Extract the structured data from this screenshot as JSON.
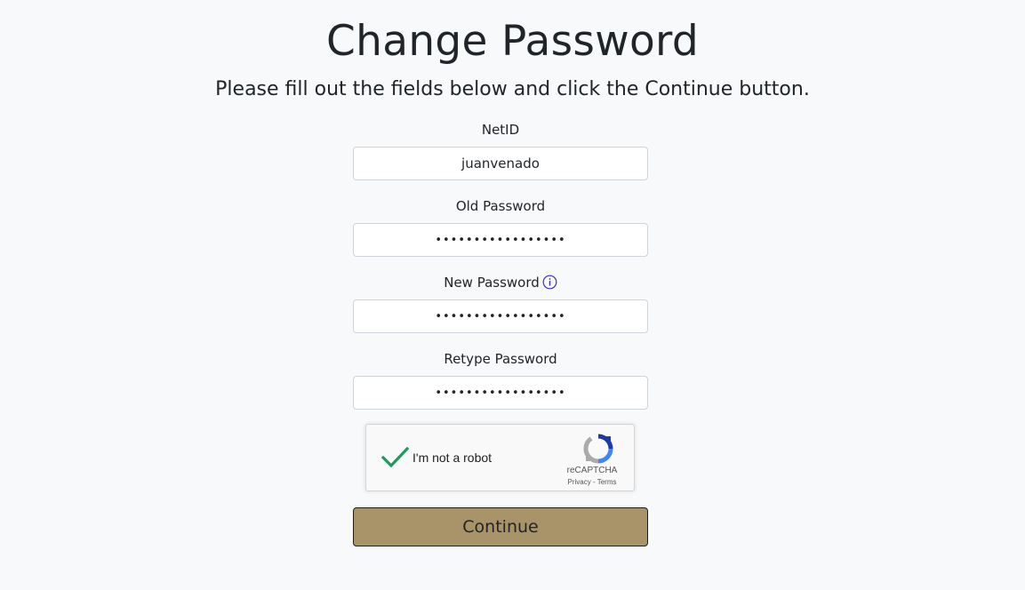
{
  "heading": {
    "title": "Change Password",
    "subtitle": "Please fill out the fields below and click the Continue button."
  },
  "form": {
    "netid": {
      "label": "NetID",
      "value": "juanvenado"
    },
    "old_password": {
      "label": "Old Password",
      "value": "•••••••••••••••••"
    },
    "new_password": {
      "label": "New Password",
      "value": "•••••••••••••••••",
      "info_icon": "info-circle-icon"
    },
    "retype_password": {
      "label": "Retype Password",
      "value": "•••••••••••••••••"
    }
  },
  "recaptcha": {
    "label": "I'm not a robot",
    "checked": true,
    "brand": "reCAPTCHA",
    "privacy": "Privacy",
    "separator": " - ",
    "terms": "Terms",
    "check_color": "#1e9b5a"
  },
  "actions": {
    "continue_label": "Continue",
    "continue_color": "#a89468"
  }
}
